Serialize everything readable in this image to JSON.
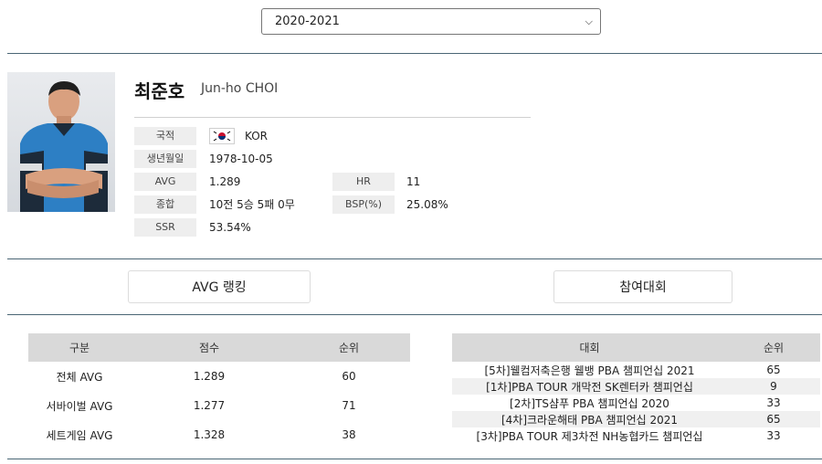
{
  "season_select": {
    "value": "2020-2021"
  },
  "player": {
    "name_kr": "최준호",
    "name_en": "Jun-ho CHOI",
    "nationality_label": "국적",
    "nationality": "KOR",
    "birth_label": "생년월일",
    "birth": "1978-10-05",
    "avg_label": "AVG",
    "avg": "1.289",
    "hr_label": "HR",
    "hr": "11",
    "record_label": "종합",
    "record": "10전 5승 5패 0무",
    "bsp_label": "BSP(%)",
    "bsp": "25.08%",
    "ssr_label": "SSR",
    "ssr": "53.54%"
  },
  "tabs": {
    "avg_ranking": "AVG 랭킹",
    "tournaments": "참여대회"
  },
  "avg_table": {
    "headers": [
      "구분",
      "점수",
      "순위"
    ],
    "rows": [
      [
        "전체 AVG",
        "1.289",
        "60"
      ],
      [
        "서바이벌 AVG",
        "1.277",
        "71"
      ],
      [
        "세트게임 AVG",
        "1.328",
        "38"
      ]
    ]
  },
  "tour_table": {
    "headers": [
      "대회",
      "순위"
    ],
    "rows": [
      [
        "[5차]웰컴저축은행 웰뱅 PBA 챔피언십 2021",
        "65"
      ],
      [
        "[1차]PBA TOUR 개막전 SK렌터카 챔피언십",
        "9"
      ],
      [
        "[2차]TS샴푸 PBA 챔피언십 2020",
        "33"
      ],
      [
        "[4차]크라운해태 PBA 챔피언십 2021",
        "65"
      ],
      [
        "[3차]PBA TOUR 제3차전 NH농협카드 챔피언십",
        "33"
      ]
    ]
  },
  "colors": {
    "divider": "#4a6675",
    "label_bg": "#eeeeee",
    "table_header_bg": "#d9d9d9",
    "row_shade": "#f0f0f0"
  },
  "icons": {
    "select_caret": "chevron-down-icon",
    "flag": "korea-flag-icon"
  }
}
